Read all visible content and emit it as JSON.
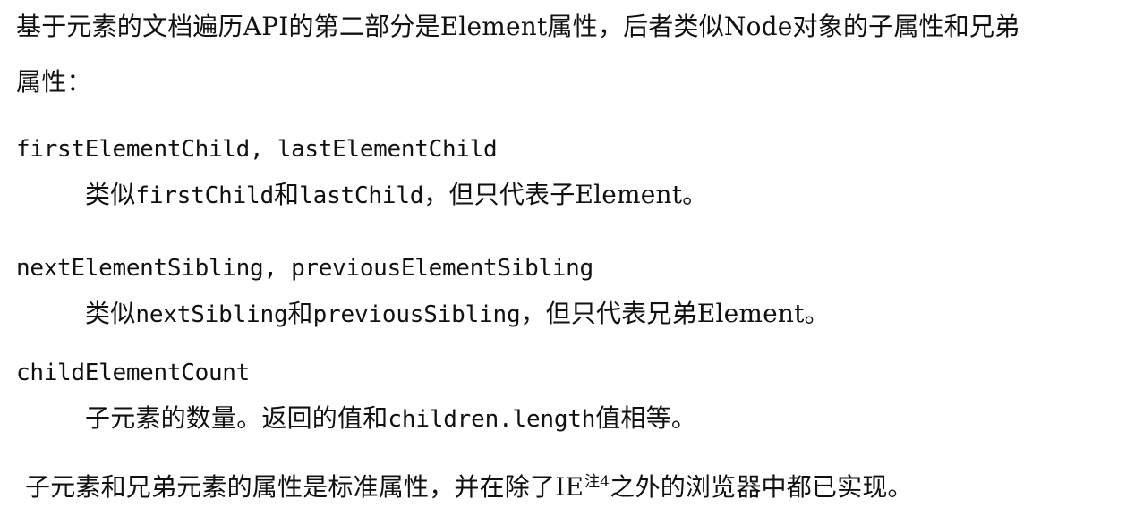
{
  "intro": {
    "line1": "基于元素的文档遍历API的第二部分是Element属性，后者类似Node对象的子属性和兄弟",
    "line2": "属性："
  },
  "definitions": [
    {
      "term": "firstElementChild, lastElementChild",
      "desc_prefix": "类似",
      "desc_code1": "firstChild",
      "desc_mid": "和",
      "desc_code2": "lastChild",
      "desc_suffix": "，但只代表子Element。"
    },
    {
      "term": "nextElementSibling, previousElementSibling",
      "desc_prefix": "类似",
      "desc_code1": "nextSibling",
      "desc_mid": "和",
      "desc_code2": "previousSibling",
      "desc_suffix": "，但只代表兄弟Element。"
    },
    {
      "term": "childElementCount",
      "desc_prefix": "子元素的数量。返回的值和",
      "desc_code1": "children.length",
      "desc_mid": "",
      "desc_code2": "",
      "desc_suffix": "值相等。"
    }
  ],
  "closing": {
    "prefix": "子元素和兄弟元素的属性是标准属性，并在除了IE",
    "footnote": "注4",
    "suffix": "之外的浏览器中都已实现。"
  }
}
